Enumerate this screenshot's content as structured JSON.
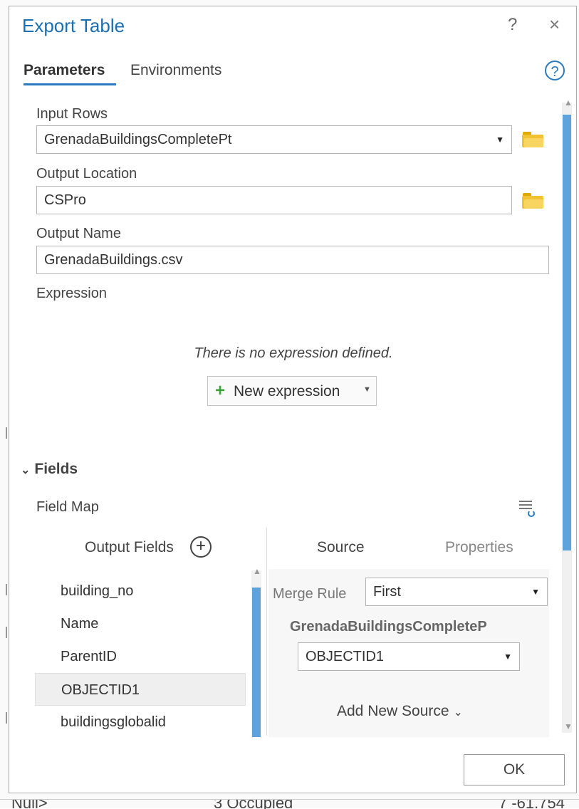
{
  "dialog": {
    "title": "Export Table",
    "help": "?",
    "close": "×"
  },
  "tabs": [
    {
      "label": "Parameters",
      "active": true
    },
    {
      "label": "Environments",
      "active": false
    }
  ],
  "params": {
    "input_rows": {
      "label": "Input Rows",
      "value": "GrenadaBuildingsCompletePt"
    },
    "output_location": {
      "label": "Output Location",
      "value": "CSPro"
    },
    "output_name": {
      "label": "Output Name",
      "value": "GrenadaBuildings.csv"
    },
    "expression": {
      "label": "Expression",
      "empty_text": "There is no expression defined.",
      "new_button": "New expression"
    }
  },
  "fields": {
    "section_label": "Fields",
    "field_map_label": "Field Map",
    "output_fields_header": "Output Fields",
    "items": [
      "building_no",
      "Name",
      "ParentID",
      "OBJECTID1",
      "buildingsglobalid"
    ],
    "selected": "OBJECTID1"
  },
  "source": {
    "tab_source": "Source",
    "tab_properties": "Properties",
    "merge_rule_label": "Merge Rule",
    "merge_rule_value": "First",
    "source_name": "GrenadaBuildingsCompleteP",
    "source_field": "OBJECTID1",
    "add_new_source": "Add New Source"
  },
  "footer": {
    "ok": "OK"
  },
  "background": {
    "row_text_a": "Null>",
    "row_text_b": "3 Occupied",
    "row_text_c": "7 -61.754"
  },
  "colors": {
    "accent": "#2a7abf",
    "title": "#1b6fb3",
    "folder": "#f2c230",
    "scroll_thumb": "#5ea3dc"
  }
}
